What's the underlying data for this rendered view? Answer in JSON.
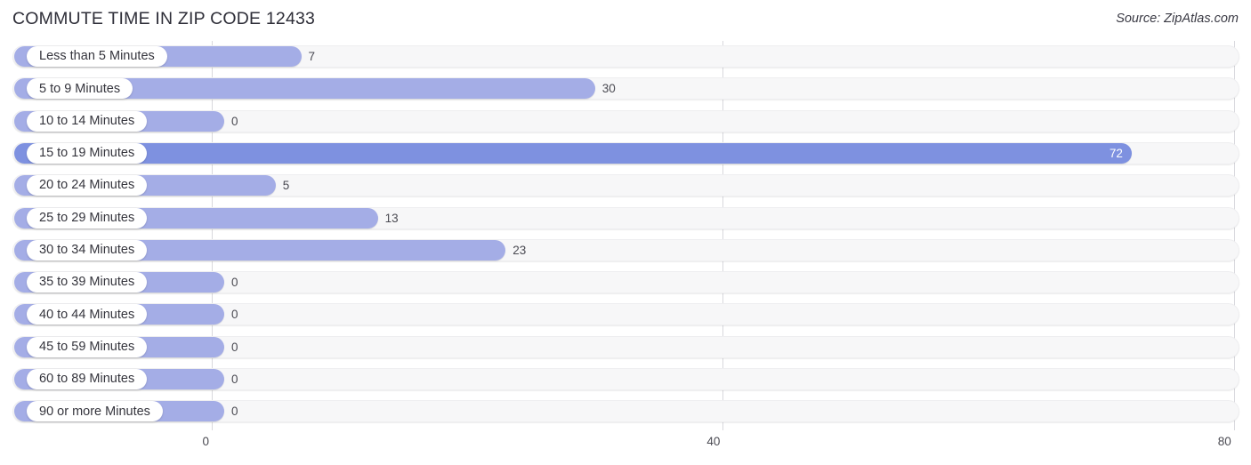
{
  "header": {
    "title": "COMMUTE TIME IN ZIP CODE 12433",
    "source": "Source: ZipAtlas.com"
  },
  "colors": {
    "bar": "#a4ade6",
    "bar_highlight": "#7e91e0",
    "track": "#f7f7f8",
    "gridline": "#d8d8dd",
    "text": "#4a4a52"
  },
  "chart_data": {
    "type": "bar",
    "orientation": "horizontal",
    "title": "COMMUTE TIME IN ZIP CODE 12433",
    "xlabel": "",
    "ylabel": "",
    "xlim": [
      0,
      80
    ],
    "xticks": [
      0,
      40,
      80
    ],
    "xtick_labels": [
      "0",
      "40",
      "80"
    ],
    "grid": true,
    "legend": false,
    "highlight_category": "15 to 19 Minutes",
    "categories": [
      "Less than 5 Minutes",
      "5 to 9 Minutes",
      "10 to 14 Minutes",
      "15 to 19 Minutes",
      "20 to 24 Minutes",
      "25 to 29 Minutes",
      "30 to 34 Minutes",
      "35 to 39 Minutes",
      "40 to 44 Minutes",
      "45 to 59 Minutes",
      "60 to 89 Minutes",
      "90 or more Minutes"
    ],
    "values": [
      7,
      30,
      0,
      72,
      5,
      13,
      23,
      0,
      0,
      0,
      0,
      0
    ],
    "value_labels": [
      "7",
      "30",
      "0",
      "72",
      "5",
      "13",
      "23",
      "0",
      "0",
      "0",
      "0",
      "0"
    ]
  },
  "rows": [
    {
      "label": "Less than 5 Minutes",
      "value": "7",
      "highlight": false
    },
    {
      "label": "5 to 9 Minutes",
      "value": "30",
      "highlight": false
    },
    {
      "label": "10 to 14 Minutes",
      "value": "0",
      "highlight": false
    },
    {
      "label": "15 to 19 Minutes",
      "value": "72",
      "highlight": true
    },
    {
      "label": "20 to 24 Minutes",
      "value": "5",
      "highlight": false
    },
    {
      "label": "25 to 29 Minutes",
      "value": "13",
      "highlight": false
    },
    {
      "label": "30 to 34 Minutes",
      "value": "23",
      "highlight": false
    },
    {
      "label": "35 to 39 Minutes",
      "value": "0",
      "highlight": false
    },
    {
      "label": "40 to 44 Minutes",
      "value": "0",
      "highlight": false
    },
    {
      "label": "45 to 59 Minutes",
      "value": "0",
      "highlight": false
    },
    {
      "label": "60 to 89 Minutes",
      "value": "0",
      "highlight": false
    },
    {
      "label": "90 or more Minutes",
      "value": "0",
      "highlight": false
    }
  ],
  "axis": {
    "ticks": [
      {
        "label": "0",
        "value": 0
      },
      {
        "label": "40",
        "value": 40
      },
      {
        "label": "80",
        "value": 80
      }
    ]
  }
}
